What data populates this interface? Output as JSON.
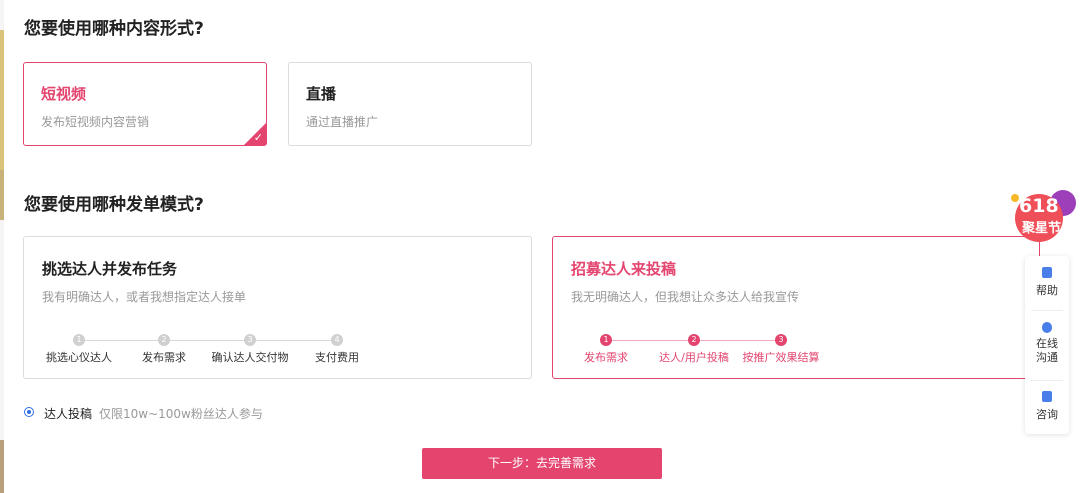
{
  "content_form": {
    "question": "您要使用哪种内容形式?",
    "options": [
      {
        "title": "短视频",
        "desc": "发布短视频内容营销",
        "selected": true
      },
      {
        "title": "直播",
        "desc": "通过直播推广",
        "selected": false
      }
    ]
  },
  "order_mode": {
    "question": "您要使用哪种发单模式?",
    "options": [
      {
        "title": "挑选达人并发布任务",
        "desc": "我有明确达人，或者我想指定达人接单",
        "steps": [
          {
            "num": "1",
            "label": "挑选心仪达人"
          },
          {
            "num": "2",
            "label": "发布需求"
          },
          {
            "num": "3",
            "label": "确认达人交付物"
          },
          {
            "num": "4",
            "label": "支付费用"
          }
        ],
        "selected": false
      },
      {
        "title": "招募达人来投稿",
        "desc": "我无明确达人，但我想让众多达人给我宣传",
        "steps": [
          {
            "num": "1",
            "label": "发布需求"
          },
          {
            "num": "2",
            "label": "达人/用户投稿"
          },
          {
            "num": "3",
            "label": "按推广效果结算"
          }
        ],
        "selected": true
      }
    ]
  },
  "submission": {
    "label": "达人投稿",
    "note": "仅限10w~100w粉丝达人参与",
    "selected": true
  },
  "next_button": "下一步：去完善需求",
  "side_panel": {
    "items": [
      {
        "label": "帮助",
        "icon": "document-icon"
      },
      {
        "label": "在线沟通",
        "icon": "chat-bubble-icon"
      },
      {
        "label": "咨询",
        "icon": "message-icon"
      }
    ]
  },
  "promo_badge": {
    "number": "618",
    "text": "聚星节"
  },
  "colors": {
    "accent": "#e4456f",
    "radio": "#2f6fe0",
    "side_icon": "#4a7ee8"
  }
}
